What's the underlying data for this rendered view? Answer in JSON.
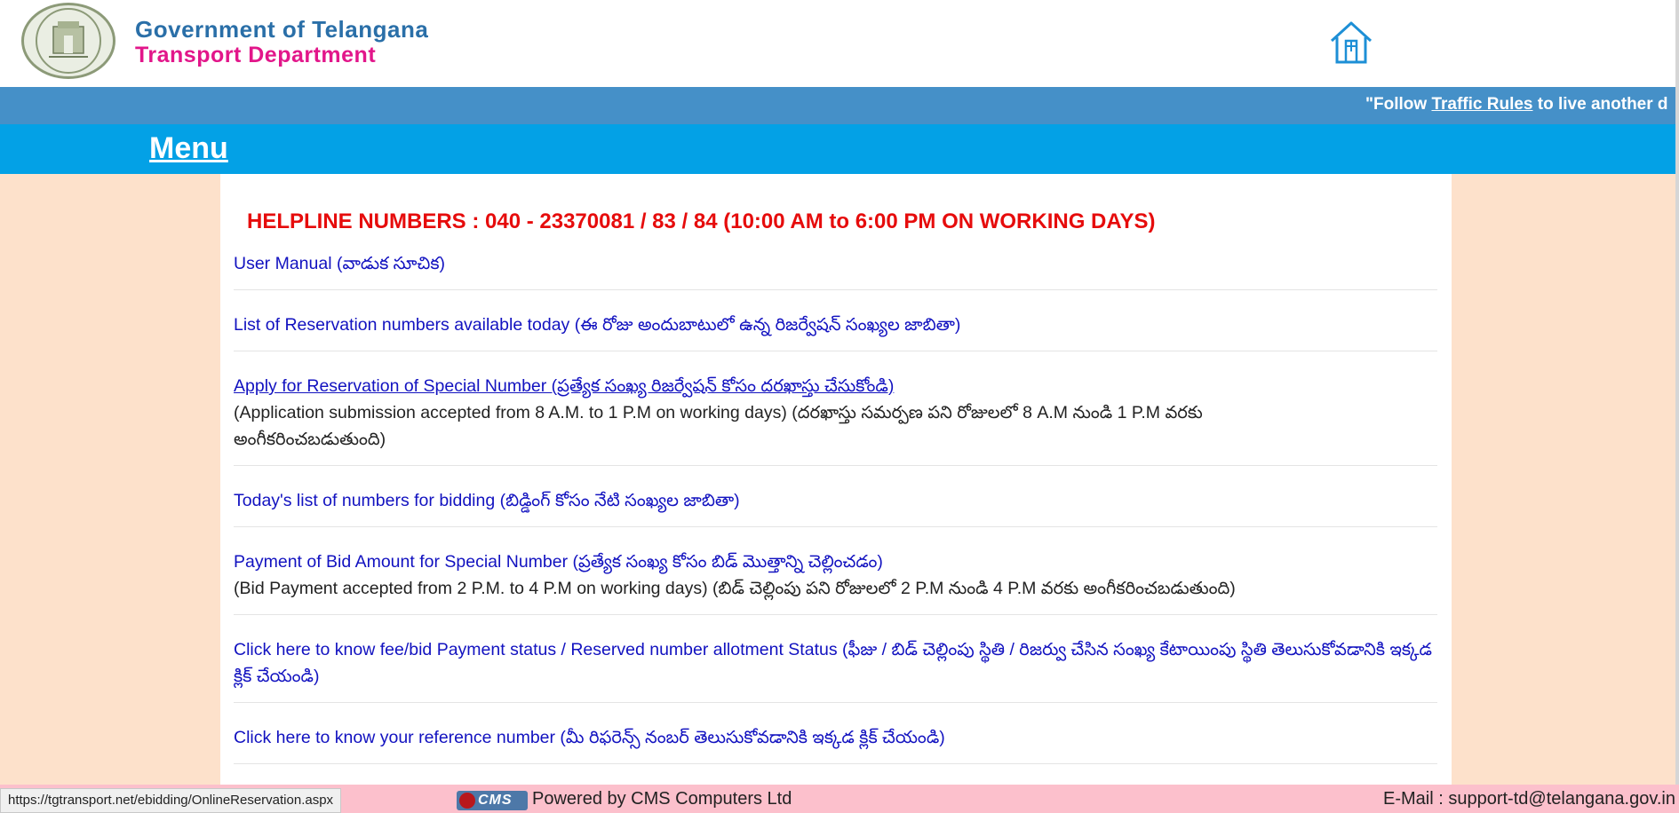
{
  "header": {
    "emblem_icon": "telangana-state-emblem",
    "org_name": "Government of Telangana",
    "department": "Transport Department",
    "home_icon": "home-icon",
    "colors": {
      "org_name": "#2a6fa8",
      "department": "#e2168a"
    }
  },
  "ticker": {
    "prefix": "\"Follow ",
    "link": "Traffic Rules",
    "suffix": " to live another d"
  },
  "menu": {
    "label": "Menu"
  },
  "helpline": "HELPLINE NUMBERS : 040 - 23370081 / 83 / 84 (10:00 AM to 6:00 PM ON WORKING DAYS)",
  "items": [
    {
      "label": "User Manual (వాడుక సూచిక)"
    },
    {
      "label": "List of Reservation numbers available today (ఈ రోజు అందుబాటులో ఉన్న రిజర్వేషన్ సంఖ్యల జాబితా)"
    },
    {
      "label": "Apply for Reservation of Special Number (ప్రత్యేక సంఖ్య రిజర్వేషన్ కోసం దరఖాస్తు చేసుకోండి)",
      "note": "(Application submission accepted from 8 A.M. to 1 P.M on working days) (దరఖాస్తు సమర్పణ పని రోజులలో 8 A.M నుండి 1 P.M వరకు అంగీకరించబడుతుంది)"
    },
    {
      "label": "Today's list of numbers for bidding (బిడ్డింగ్ కోసం నేటి సంఖ్యల జాబితా)"
    },
    {
      "label": "Payment of Bid Amount for Special Number (ప్రత్యేక సంఖ్య కోసం బిడ్ మొత్తాన్ని చెల్లించడం)",
      "note": "(Bid Payment accepted from 2 P.M. to 4 P.M on working days) (బిడ్ చెల్లింపు పని రోజులలో 2 P.M నుండి 4 P.M వరకు అంగీకరించబడుతుంది)"
    },
    {
      "label": "Click here to know fee/bid Payment status / Reserved number allotment Status (ఫీజు / బిడ్ చెల్లింపు స్థితి / రిజర్వు చేసిన సంఖ్య కేటాయింపు స్థితి తెలుసుకోవడానికి ఇక్కడ క్లిక్ చేయండి)"
    },
    {
      "label": "Click here to know your reference number (మీ రిఫరెన్స్ నంబర్ తెలుసుకోవడానికి ఇక్కడ క్లిక్ చేయండి)"
    }
  ],
  "footer": {
    "status_url": "https://tgtransport.net/ebidding/OnlineReservation.aspx",
    "cms_logo_text": "CMS",
    "powered_by": "Powered by CMS Computers Ltd",
    "email": "E-Mail : support-td@telangana.gov.in"
  },
  "colors": {
    "ticker_bg": "#4590c8",
    "menu_bg": "#03a1e6",
    "page_bg": "#fde1cb",
    "helpline": "#e60c0c",
    "link": "#1212c0",
    "footer_bg": "#fcc0cc"
  }
}
